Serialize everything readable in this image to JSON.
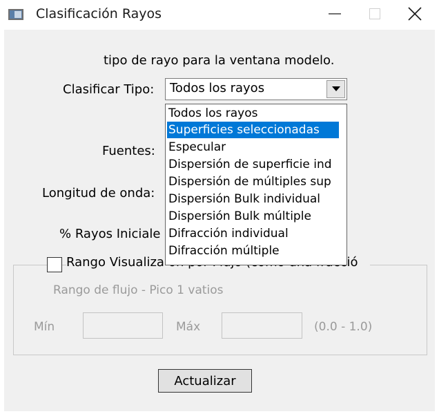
{
  "window": {
    "title": "Clasificación Rayos",
    "controls": {
      "minimize": "—",
      "maximize": "☐",
      "close": "✕"
    }
  },
  "dialog": {
    "instruction": "tipo de rayo para la ventana modelo.",
    "classify_label": "Clasificar Tipo:",
    "classify_value": "Todos los rayos",
    "sources_label": "Fuentes:",
    "wavelength_label": "Longitud de onda:",
    "initial_rays_label": "% Rayos Iniciale",
    "dropdown_options": [
      "Todos los rayos",
      "Superficies seleccionadas",
      "Especular",
      "Dispersión de superficie ind",
      "Dispersión de múltiples sup",
      "Dispersión Bulk individual",
      "Dispersión Bulk múltiple",
      "Difracción individual",
      "Difracción múltiple"
    ],
    "highlighted_option": "Superficies seleccionadas",
    "flux_group": {
      "checkbox_label_left": "Rango Visualiza",
      "checkbox_label_right": "ón por Flujo (como una fracció",
      "checked": false,
      "range_label": "Rango de flujo - Pico 1 vatios",
      "min_label": "Mín",
      "min_value": "",
      "max_label": "Máx",
      "max_value": "",
      "range_hint": "(0.0 - 1.0)"
    },
    "update_button": "Actualizar"
  },
  "colors": {
    "highlight": "#0078d7",
    "dialog_bg": "#f0f0f0",
    "disabled_text": "#9a9a9a"
  }
}
